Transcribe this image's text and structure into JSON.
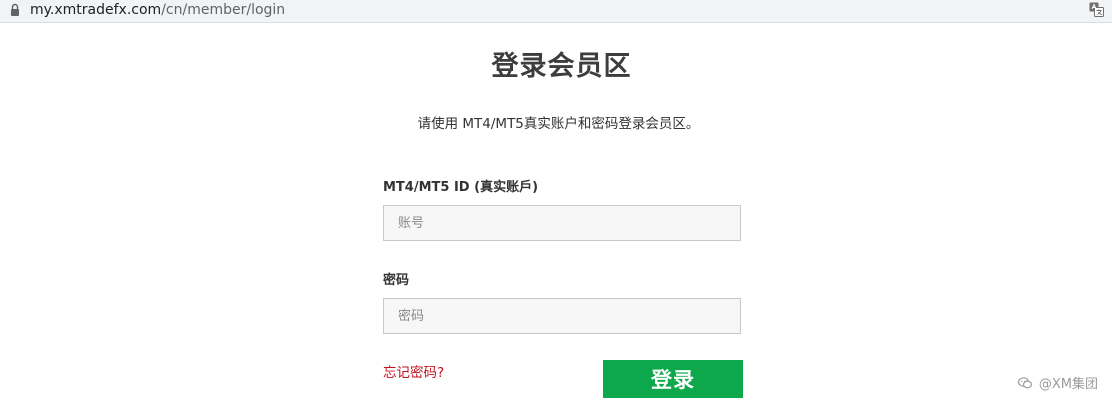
{
  "browser": {
    "url_host": "my.xmtradefx.com",
    "url_path": "/cn/member/login"
  },
  "page": {
    "title": "登录会员区",
    "subtitle": "请使用 MT4/MT5真实账户和密码登录会员区。"
  },
  "form": {
    "account_label": "MT4/MT5 ID (真实账戶)",
    "account_placeholder": "账号",
    "account_value": "",
    "password_label": "密码",
    "password_placeholder": "密码",
    "password_value": "",
    "forgot_link": "忘记密码?",
    "login_button": "登录"
  },
  "watermark": {
    "text": "@XM集团"
  },
  "colors": {
    "button_green": "#0ca84b",
    "link_red": "#c2101d",
    "title_gray": "#3d3d3d"
  },
  "icons": {
    "address_bar": "lock-icon",
    "toolbar": "translate-icon",
    "watermark": "wechat-icon"
  }
}
